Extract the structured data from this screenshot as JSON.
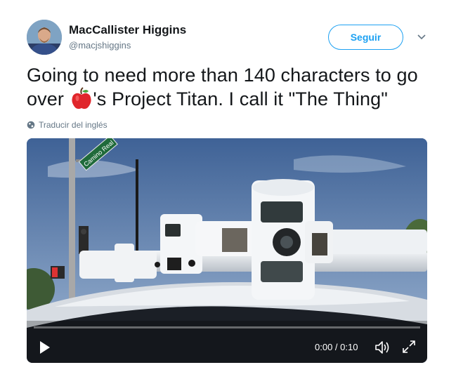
{
  "author": {
    "name": "MacCallister Higgins",
    "handle": "@macjshiggins",
    "avatar_icon": "avatar-photo"
  },
  "follow_button": {
    "label": "Seguir"
  },
  "tweet": {
    "text_before": "Going to need more than 140 characters to go over ",
    "emoji": "red-apple-emoji",
    "text_after": "'s Project Titan. I call it \"The Thing\""
  },
  "translate_link": {
    "label": "Traducir del inglés",
    "icon": "globe-icon"
  },
  "video": {
    "time": "0:00 / 0:10",
    "progress": 0,
    "street_sign": "Camino Real"
  },
  "colors": {
    "accent": "#1da1f2",
    "text": "#14171a",
    "muted": "#657786"
  }
}
